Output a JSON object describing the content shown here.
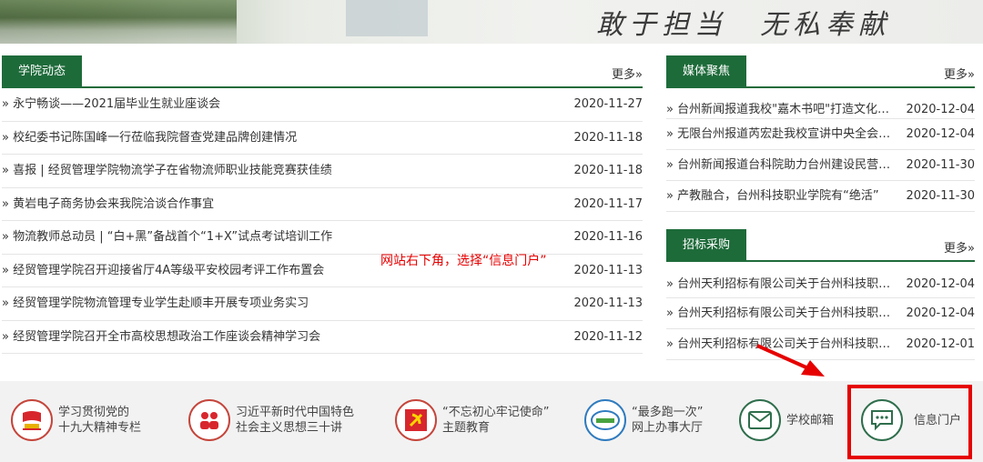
{
  "banner": {
    "slogan": "敢于担当　无私奉献"
  },
  "news": {
    "tab": "学院动态",
    "more": "更多»",
    "items": [
      {
        "title": "» 永宁畅谈——2021届毕业生就业座谈会",
        "date": "2020-11-27"
      },
      {
        "title": "» 校纪委书记陈国峰一行莅临我院督查党建品牌创建情况",
        "date": "2020-11-18"
      },
      {
        "title": "» 喜报 | 经贸管理学院物流学子在省物流师职业技能竞赛获佳绩",
        "date": "2020-11-18"
      },
      {
        "title": "» 黄岩电子商务协会来我院洽谈合作事宜",
        "date": "2020-11-17"
      },
      {
        "title": "» 物流教师总动员 | “白+黑”备战首个“1+X”试点考试培训工作",
        "date": "2020-11-16"
      },
      {
        "title": "» 经贸管理学院召开迎接省厅4A等级平安校园考评工作布置会",
        "date": "2020-11-13"
      },
      {
        "title": "» 经贸管理学院物流管理专业学生赴顺丰开展专项业务实习",
        "date": "2020-11-13"
      },
      {
        "title": "» 经贸管理学院召开全市高校思想政治工作座谈会精神学习会",
        "date": "2020-11-12"
      }
    ]
  },
  "media": {
    "tab": "媒体聚焦",
    "more": "更多»",
    "items": [
      {
        "title": "» 台州新闻报道我校\"嘉木书吧\"打造文化…",
        "date": "2020-12-04"
      },
      {
        "title": "» 无限台州报道芮宏赴我校宣讲中央全会…",
        "date": "2020-12-04"
      },
      {
        "title": "» 台州新闻报道台科院助力台州建设民营…",
        "date": "2020-11-30"
      },
      {
        "title": "» 产教融合，台州科技职业学院有“绝活”",
        "date": "2020-11-30"
      }
    ]
  },
  "bidding": {
    "tab": "招标采购",
    "more": "更多»",
    "items": [
      {
        "title": "» 台州天利招标有限公司关于台州科技职…",
        "date": "2020-12-04"
      },
      {
        "title": "» 台州天利招标有限公司关于台州科技职…",
        "date": "2020-12-04"
      },
      {
        "title": "» 台州天利招标有限公司关于台州科技职…",
        "date": "2020-12-01"
      }
    ]
  },
  "annotation": "网站右下角，选择“信息门户”",
  "footer": {
    "links": [
      {
        "line1": "学习贯彻党的",
        "line2": "十九大精神专栏",
        "icon": "flag-icon"
      },
      {
        "line1": "习近平新时代中国特色",
        "line2": "社会主义思想三十讲",
        "icon": "people-icon"
      },
      {
        "line1": "“不忘初心牢记使命”",
        "line2": "主题教育",
        "icon": "party-emblem-icon"
      },
      {
        "line1": "“最多跑一次”",
        "line2": "网上办事大厅",
        "icon": "service-hall-icon"
      },
      {
        "line1": "学校邮箱",
        "line2": "",
        "icon": "mail-icon"
      },
      {
        "line1": "信息门户",
        "line2": "",
        "icon": "chat-icon"
      }
    ]
  },
  "colors": {
    "accent": "#1e6b3a",
    "highlight": "#e60000"
  }
}
